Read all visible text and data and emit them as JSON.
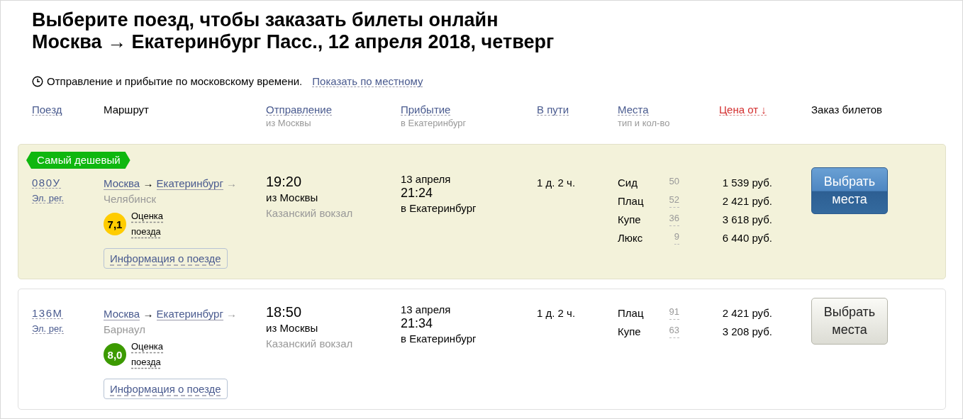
{
  "title": [
    "Выберите поезд, чтобы заказать билеты онлайн",
    "Москва → Екатеринбург Пасс., 12 апреля 2018, четверг"
  ],
  "time_note": {
    "text": "Отправление и прибытие по московскому времени.",
    "link": "Показать по местному"
  },
  "columns": [
    {
      "label": "Поезд",
      "sortable": true,
      "sorted": false
    },
    {
      "label": "Маршрут",
      "sortable": false,
      "sorted": false
    },
    {
      "label": "Отправление",
      "sublabel": "из Москвы",
      "sortable": true,
      "sorted": false
    },
    {
      "label": "Прибытие",
      "sublabel": "в Екатеринбург",
      "sortable": true,
      "sorted": false
    },
    {
      "label": "В пути",
      "sortable": true,
      "sorted": false
    },
    {
      "label": "Места",
      "sublabel": "тип и кол-во",
      "sortable": true,
      "sorted": false
    },
    {
      "label": "Цена от ↓",
      "sortable": true,
      "sorted": true
    },
    {
      "label": "Заказ билетов",
      "sortable": false,
      "sorted": false
    }
  ],
  "trains": [
    {
      "highlighted": true,
      "badge": "Самый дешевый",
      "number": "080У",
      "category": "Эл. рег.",
      "separator": "→",
      "route": [
        {
          "name": "Москва",
          "link": true
        },
        {
          "name": "Екатеринбург",
          "link": true
        },
        {
          "name": "Челябинск",
          "link": false
        }
      ],
      "rating": {
        "score": "7,1",
        "color": "#ffcc00",
        "label": "Оценка поезда"
      },
      "info_button": "Информация о поезде",
      "departure_time": "19:20",
      "departure_note": "из Москвы",
      "departure_station": "Казанский вокзал",
      "arrival_date": "13 апреля",
      "arrival_time": "21:24",
      "arrival_note": "в Екатеринбург",
      "duration": "1 д. 2 ч.",
      "seats": [
        {
          "type": "Сид",
          "count": "50",
          "clickable": false,
          "price": "1 539 руб."
        },
        {
          "type": "Плац",
          "count": "52",
          "clickable": true,
          "price": "2 421 руб."
        },
        {
          "type": "Купе",
          "count": "36",
          "clickable": true,
          "price": "3 618 руб."
        },
        {
          "type": "Люкс",
          "count": "9",
          "clickable": true,
          "price": "6 440 руб."
        }
      ],
      "button": {
        "label": "Выбрать места",
        "primary": true
      }
    },
    {
      "highlighted": false,
      "number": "136М",
      "category": "Эл. рег.",
      "separator": "→",
      "route": [
        {
          "name": "Москва",
          "link": true
        },
        {
          "name": "Екатеринбург",
          "link": true
        },
        {
          "name": "Барнаул",
          "link": false
        }
      ],
      "rating": {
        "score": "8,0",
        "color": "#3c9a00",
        "label": "Оценка поезда"
      },
      "info_button": "Информация о поезде",
      "departure_time": "18:50",
      "departure_note": "из Москвы",
      "departure_station": "Казанский вокзал",
      "arrival_date": "13 апреля",
      "arrival_time": "21:34",
      "arrival_note": "в Екатеринбург",
      "duration": "1 д. 2 ч.",
      "seats": [
        {
          "type": "Плац",
          "count": "91",
          "clickable": true,
          "price": "2 421 руб."
        },
        {
          "type": "Купе",
          "count": "63",
          "clickable": true,
          "price": "3 208 руб."
        }
      ],
      "button": {
        "label": "Выбрать места",
        "primary": false
      }
    }
  ]
}
